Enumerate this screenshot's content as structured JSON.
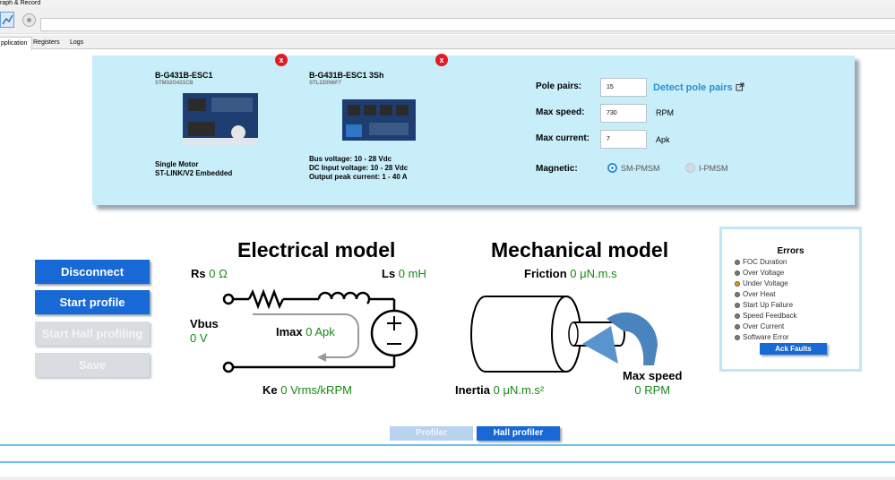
{
  "window": {
    "title": "raph & Record"
  },
  "tabs": [
    {
      "label": "pplication",
      "active": true
    },
    {
      "label": "Registers",
      "active": false
    },
    {
      "label": "Logs",
      "active": false
    }
  ],
  "boards": [
    {
      "name": "B-G431B-ESC1",
      "chip": "STM32G431CB",
      "desc": [
        "Single Motor",
        "ST-LINK/V2 Embedded"
      ],
      "close": "x"
    },
    {
      "name": "B-G431B-ESC1 3Sh",
      "chip": "STL220N6F7",
      "desc": [
        "Bus voltage: 10 - 28 Vdc",
        "DC Input voltage: 10 - 28 Vdc",
        "Output peak current: 1 - 40 A"
      ],
      "close": "x"
    }
  ],
  "params": {
    "pole_pairs": {
      "label": "Pole pairs:",
      "value": "15"
    },
    "detect_link": "Detect pole pairs",
    "max_speed": {
      "label": "Max speed:",
      "value": "730",
      "unit": "RPM"
    },
    "max_current": {
      "label": "Max current:",
      "value": "7",
      "unit": "Apk"
    },
    "magnetic": {
      "label": "Magnetic:",
      "options": [
        {
          "label": "SM-PMSM",
          "selected": true
        },
        {
          "label": "I-PMSM",
          "selected": false
        }
      ]
    }
  },
  "buttons": {
    "disconnect": "Disconnect",
    "start_profile": "Start profile",
    "start_hall": "Start Hall profiling",
    "save": "Save"
  },
  "electrical": {
    "title": "Electrical model",
    "rs": {
      "label": "Rs",
      "value": "0 Ω"
    },
    "ls": {
      "label": "Ls",
      "value": "0 mH"
    },
    "vbus": {
      "label": "Vbus",
      "value": "0 V"
    },
    "imax": {
      "label": "Imax",
      "value": "0 Apk"
    },
    "ke": {
      "label": "Ke",
      "value": "0 Vrms/kRPM"
    }
  },
  "mechanical": {
    "title": "Mechanical model",
    "friction": {
      "label": "Friction",
      "value": "0 μN.m.s"
    },
    "inertia": {
      "label": "Inertia",
      "value": "0 μN.m.s²"
    },
    "max_speed": {
      "label": "Max speed",
      "value": "0 RPM"
    }
  },
  "errors": {
    "title": "Errors",
    "items": [
      {
        "label": "FOC Duration",
        "color": "#7a7a7a"
      },
      {
        "label": "Over Voltage",
        "color": "#7a7a7a"
      },
      {
        "label": "Under Voltage",
        "color": "#e89a1c"
      },
      {
        "label": "Over Heat",
        "color": "#7a7a7a"
      },
      {
        "label": "Start Up Failure",
        "color": "#7a7a7a"
      },
      {
        "label": "Speed Feedback",
        "color": "#7a7a7a"
      },
      {
        "label": "Over Current",
        "color": "#7a7a7a"
      },
      {
        "label": "Software Error",
        "color": "#7a7a7a"
      }
    ],
    "ack": "Ack Faults"
  },
  "bottom_tabs": [
    {
      "label": "Profiler",
      "active": false
    },
    {
      "label": "Hall profiler",
      "active": true
    }
  ],
  "colors": {
    "accent": "#1769d6",
    "panel": "#c8eefa",
    "value_green": "#148a14",
    "close_red": "#e11b22"
  }
}
